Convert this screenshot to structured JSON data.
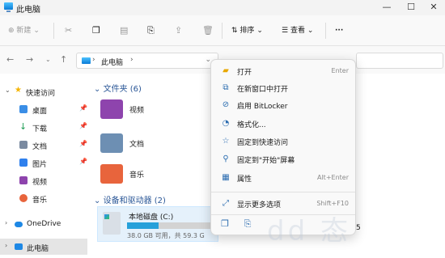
{
  "window": {
    "title": "此电脑",
    "minimize": "—",
    "maximize": "☐",
    "close": "✕"
  },
  "toolbar": {
    "new_label": "新建",
    "sort_label": "排序",
    "view_label": "查看",
    "more_label": "···"
  },
  "address": {
    "path": [
      "此电脑"
    ]
  },
  "sidebar": {
    "items": [
      {
        "label": "快速访问",
        "icon": "star-icon",
        "color": "#f5b400"
      },
      {
        "label": "桌面",
        "icon": "desktop-icon",
        "color": "#3a8ee6",
        "pinned": true
      },
      {
        "label": "下载",
        "icon": "download-icon",
        "color": "#1f9d55",
        "pinned": true
      },
      {
        "label": "文档",
        "icon": "document-icon",
        "color": "#7a8aa0",
        "pinned": true
      },
      {
        "label": "图片",
        "icon": "pictures-icon",
        "color": "#2f80ed",
        "pinned": true
      },
      {
        "label": "视频",
        "icon": "videos-icon",
        "color": "#8e44ad"
      },
      {
        "label": "音乐",
        "icon": "music-icon",
        "color": "#e8643c"
      },
      {
        "label": "OneDrive",
        "icon": "cloud-icon",
        "color": "#1e88e5"
      },
      {
        "label": "此电脑",
        "icon": "computer-icon",
        "color": "#1e88e5"
      }
    ]
  },
  "main": {
    "folders_header": "文件夹 (6)",
    "folders": [
      {
        "name": "视频",
        "color": "#8e44ad"
      },
      {
        "name": "文档",
        "color": "#6d8fb3"
      },
      {
        "name": "音乐",
        "color": "#e8643c"
      }
    ],
    "devices_header": "设备和驱动器 (2)",
    "drive": {
      "name": "本地磁盘 (C:)",
      "free": "38.0 GB 可用，共 59.3 G",
      "used_fraction": 0.36
    },
    "trailing_text": "5"
  },
  "context_menu": {
    "items": [
      {
        "label": "打开",
        "shortcut": "Enter",
        "icon": "folder-open-icon"
      },
      {
        "label": "在新窗口中打开",
        "shortcut": "",
        "icon": "new-window-icon"
      },
      {
        "label": "启用 BitLocker",
        "shortcut": "",
        "icon": "bitlocker-icon"
      },
      {
        "label": "格式化...",
        "shortcut": "",
        "icon": "format-icon"
      },
      {
        "label": "固定到快速访问",
        "shortcut": "",
        "icon": "star-outline-icon"
      },
      {
        "label": "固定到\"开始\"屏幕",
        "shortcut": "",
        "icon": "pin-icon"
      },
      {
        "label": "属性",
        "shortcut": "Alt+Enter",
        "icon": "properties-icon"
      },
      {
        "label": "显示更多选项",
        "shortcut": "Shift+F10",
        "icon": "more-options-icon"
      }
    ]
  },
  "watermark": "dd 态"
}
